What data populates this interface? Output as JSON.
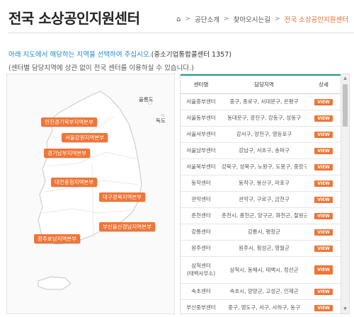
{
  "header": {
    "title": "전국 소상공인지원센터",
    "breadcrumb": [
      "공단소개",
      "찾아오시는길",
      "전국 소상공인지원센터"
    ]
  },
  "intro": {
    "line1_highlight": "아래 지도에서 해당하는 지역을 선택하여 주십시오.",
    "line1_rest": "(중소기업통합콜센터 1357)",
    "line2": "(센터별 담당지역에 상관 없이 전국 센터를 이용하실 수 있습니다.)"
  },
  "map": {
    "islands": [
      "울릉도",
      "독도"
    ],
    "regions": [
      "인천경기북부지역본부",
      "서울강원지역본부",
      "경기남부지역본부",
      "대전충청지역본부",
      "대구경북지역본부",
      "부산울산경남지역본부",
      "광주호남지역본부"
    ]
  },
  "table": {
    "headers": [
      "센터명",
      "담당지역",
      "상세"
    ],
    "view_label": "VIEW",
    "rows": [
      {
        "name": "서울중부센터",
        "area": "중구, 종로구, 서대문구, 은평구"
      },
      {
        "name": "서울동부센터",
        "area": "동대문구, 광진구, 강동구, 성동구"
      },
      {
        "name": "서울서부센터",
        "area": "강서구, 양천구, 영등포구"
      },
      {
        "name": "서울남부센터",
        "area": "강남구, 서초구, 송파구"
      },
      {
        "name": "서울북부센터",
        "area": "강북구, 성북구, 노원구, 도봉구, 중랑구"
      },
      {
        "name": "동작센터",
        "area": "동작구, 용산구, 마포구"
      },
      {
        "name": "관악센터",
        "area": "관악구, 구로구, 금천구"
      },
      {
        "name": "춘천센터",
        "area": "춘천시, 홍천군, 양구군, 화천군, 철원군 ,"
      },
      {
        "name": "강릉센터",
        "area": "강릉시, 평창군"
      },
      {
        "name": "원주센터",
        "area": "원주시, 횡성군, 영월군"
      },
      {
        "name": "삼척센터",
        "name2": "(태백사무소)",
        "area": "삼척시, 동해시, 태백시, 정선군"
      },
      {
        "name": "속초센터",
        "area": "속초시, 양양군, 고성군, 인제군"
      },
      {
        "name": "부산중부센터",
        "area": "중구, 영도구, 서구, 사하구, 동구"
      }
    ]
  }
}
